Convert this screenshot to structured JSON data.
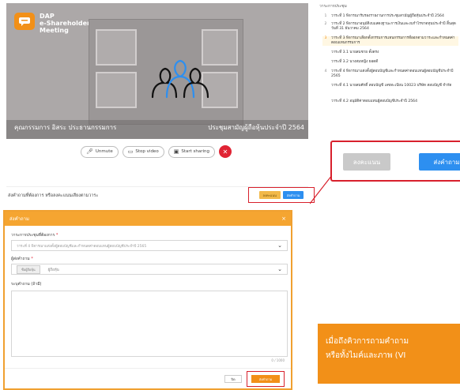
{
  "meeting": {
    "logo_line1": "DAP",
    "logo_line2": "e-Shareholder",
    "logo_line3": "Meeting",
    "caption_left": "คุณกรรมการ อิสระ ประธานกรรมการ",
    "caption_right": "ประชุมสามัญผู้ถือหุ้นประจำปี 2564",
    "controls": {
      "unmute_label": "Unmute",
      "stop_video_label": "Stop video",
      "start_sharing_label": "Start sharing"
    },
    "submit_label": "ส่งคำถามที่ต้องการ หรือลงคะแนนเสียงตามวาระ",
    "mini_vote_label": "ลงคะแนน",
    "mini_question_label": "ส่งคำถาม"
  },
  "agenda": {
    "title": "วาระการประชุม",
    "items": [
      {
        "num": "1",
        "text": "วาระที่ 1 พิจารณารับรองรายงานการประชุมสามัญผู้ถือหุ้นประจำปี 2564",
        "active": false
      },
      {
        "num": "2",
        "text": "วาระที่ 2 พิจารณาอนุมัติงบแสดงฐานะการเงินและงบกำไรขาดทุนประจำปี สิ้นสุด วันที่ 31 ธันวาคม 2564",
        "active": false
      },
      {
        "num": "3",
        "text": "วาระที่ 3 พิจารณาเลือกตั้งกรรมการแทนกรรมการที่ออกตามวาระและกำหนดค่าตอบแทนกรรมการ",
        "active": true
      },
      {
        "num": "",
        "text": "วาระที่ 3.1 นายสมชาย ตั้งตรง",
        "active": false
      },
      {
        "num": "",
        "text": "วาระที่ 3.2 นางสมหญิง ยอดดี",
        "active": false
      },
      {
        "num": "4",
        "text": "วาระที่ 4 พิจารณาแต่งตั้งผู้สอบบัญชีและกำหนดค่าตอบแทนผู้สอบบัญชีประจำปี 2565",
        "active": false
      },
      {
        "num": "",
        "text": "วาระที่ 4.1 นายสมศักดิ์ สอบบัญชี เลขทะเบียน 10023 บริษัท สอบบัญชี จำกัด",
        "active": false
      },
      {
        "num": "",
        "text": "วาระที่ 4.2 อนุมัติค่าตอบแทนผู้สอบบัญชีประจำปี 2564",
        "active": false
      }
    ]
  },
  "vote_box": {
    "vote_label": "ลงคะแนน",
    "question_label": "ส่งคำถาม"
  },
  "modal": {
    "title": "ส่งคำถาม",
    "close_glyph": "×",
    "agenda_field_label": "วาระการประชุมที่ต้องการ",
    "agenda_field_value": "วาระที่ 4 พิจารณาแต่งตั้งผู้สอบบัญชีและกำหนดค่าตอบแทนผู้สอบบัญชีประจำปี 2565",
    "asker_label": "ผู้ส่งคำถาม",
    "asker_chip": "ชื่อผู้ถือหุ้น",
    "asker_value": "ผู้ถือหุ้น",
    "detail_label": "ระบุคำถาม (ถ้ามี)",
    "counter": "0 / 1000",
    "cancel_label": "ปิด",
    "send_label": "ส่งคำถาม"
  },
  "note": {
    "line1": "เมื่อถึงคิวการถามคำถาม",
    "line2": "หรือทั้งไมค์และภาพ (VI"
  }
}
